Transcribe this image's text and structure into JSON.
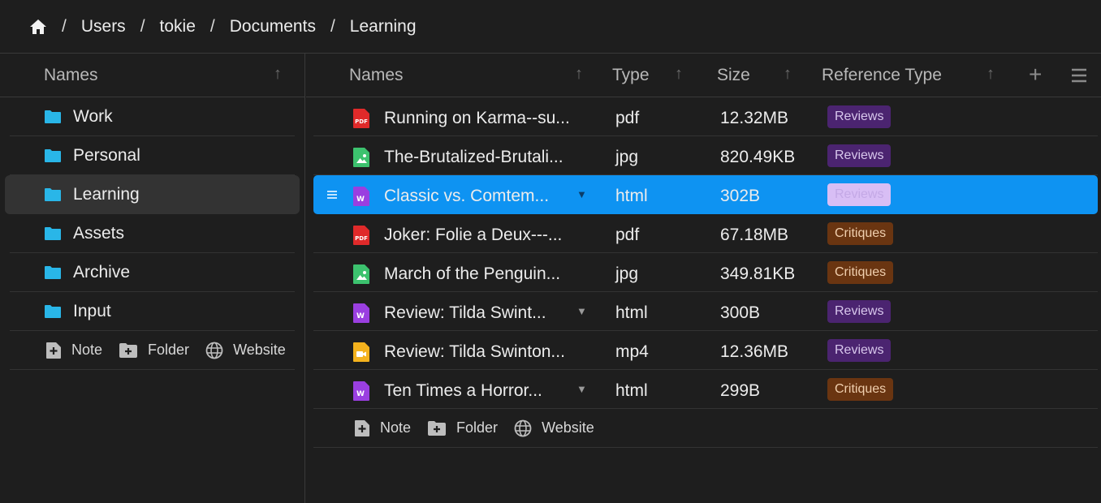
{
  "breadcrumb": {
    "items": [
      "Users",
      "tokie",
      "Documents",
      "Learning"
    ],
    "separator": "/"
  },
  "left_panel": {
    "header": "Names",
    "sort_icon": "↑",
    "folders": [
      "Work",
      "Personal",
      "Learning",
      "Assets",
      "Archive",
      "Input"
    ],
    "active_folder": "Learning",
    "add_actions": [
      "Note",
      "Folder",
      "Website"
    ]
  },
  "table": {
    "columns": [
      "Names",
      "Type",
      "Size",
      "Reference Type"
    ],
    "sort_icon": "↑",
    "add_column_icon": "+",
    "rows": [
      {
        "name": "Running on Karma--su...",
        "type": "pdf",
        "size": "12.32MB",
        "reference": "Reviews",
        "icon": "pdf-icon"
      },
      {
        "name": "The-Brutalized-Brutali...",
        "type": "jpg",
        "size": "820.49KB",
        "reference": "Reviews",
        "icon": "image-icon"
      },
      {
        "name": "Classic vs. Comtem...",
        "type": "html",
        "size": "302B",
        "reference": "Reviews",
        "icon": "html-icon",
        "selected": true,
        "expandable": true
      },
      {
        "name": "Joker: Folie a Deux---...",
        "type": "pdf",
        "size": "67.18MB",
        "reference": "Critiques",
        "icon": "pdf-icon"
      },
      {
        "name": "March of the Penguin...",
        "type": "jpg",
        "size": "349.81KB",
        "reference": "Critiques",
        "icon": "image-icon"
      },
      {
        "name": "Review: Tilda Swint...",
        "type": "html",
        "size": "300B",
        "reference": "Reviews",
        "icon": "html-icon",
        "expandable": true
      },
      {
        "name": "Review: Tilda Swinton...",
        "type": "mp4",
        "size": "12.36MB",
        "reference": "Reviews",
        "icon": "video-icon"
      },
      {
        "name": "Ten Times a Horror...",
        "type": "html",
        "size": "299B",
        "reference": "Critiques",
        "icon": "html-icon",
        "expandable": true
      }
    ],
    "add_actions": [
      "Note",
      "Folder",
      "Website"
    ]
  },
  "colors": {
    "background": "#1e1e1e",
    "selection": "#0e93f2",
    "folder": "#29b6e8",
    "reviews_badge": "#4b2470",
    "critiques_badge": "#6a3511"
  }
}
